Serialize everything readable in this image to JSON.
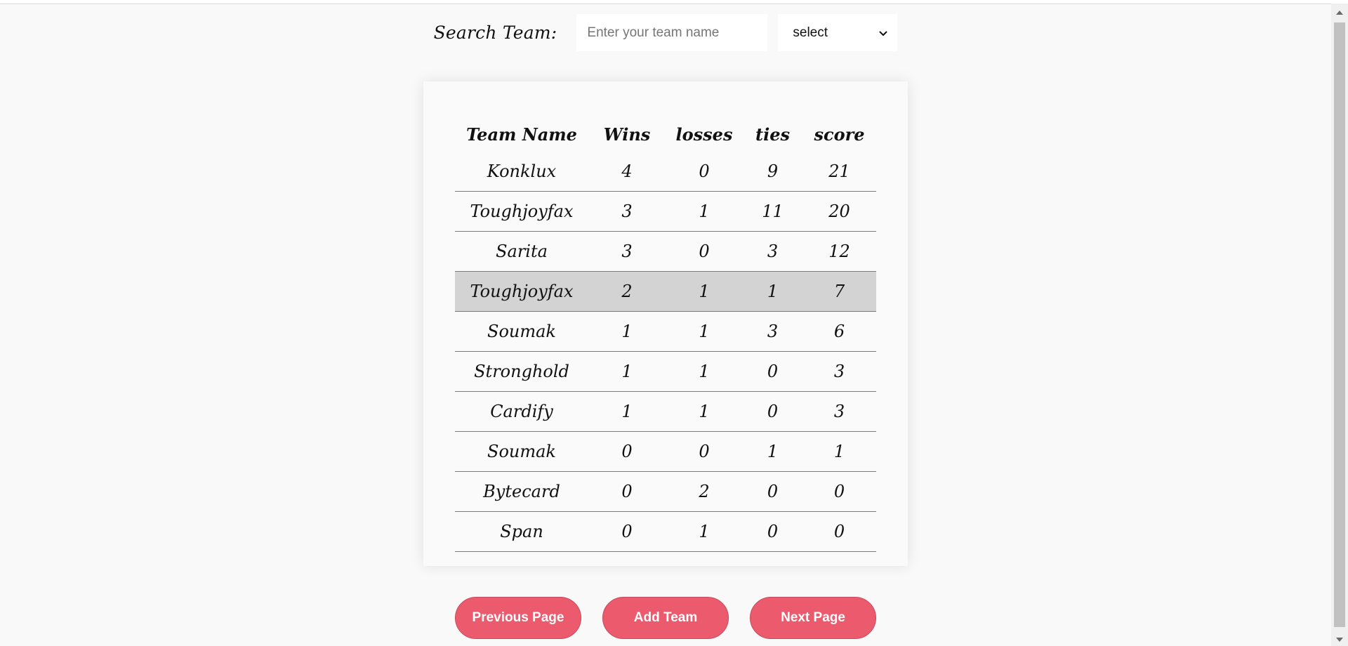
{
  "search": {
    "label": "Search Team:",
    "placeholder": "Enter your team name",
    "select_value": "select"
  },
  "table": {
    "headers": {
      "name": "Team Name",
      "wins": "Wins",
      "losses": "losses",
      "ties": "ties",
      "score": "score"
    },
    "rows": [
      {
        "name": "Konklux",
        "wins": "4",
        "losses": "0",
        "ties": "9",
        "score": "21"
      },
      {
        "name": "Toughjoyfax",
        "wins": "3",
        "losses": "1",
        "ties": "11",
        "score": "20"
      },
      {
        "name": "Sarita",
        "wins": "3",
        "losses": "0",
        "ties": "3",
        "score": "12"
      },
      {
        "name": "Toughjoyfax",
        "wins": "2",
        "losses": "1",
        "ties": "1",
        "score": "7"
      },
      {
        "name": "Soumak",
        "wins": "1",
        "losses": "1",
        "ties": "3",
        "score": "6"
      },
      {
        "name": "Stronghold",
        "wins": "1",
        "losses": "1",
        "ties": "0",
        "score": "3"
      },
      {
        "name": "Cardify",
        "wins": "1",
        "losses": "1",
        "ties": "0",
        "score": "3"
      },
      {
        "name": "Soumak",
        "wins": "0",
        "losses": "0",
        "ties": "1",
        "score": "1"
      },
      {
        "name": "Bytecard",
        "wins": "0",
        "losses": "2",
        "ties": "0",
        "score": "0"
      },
      {
        "name": "Span",
        "wins": "0",
        "losses": "1",
        "ties": "0",
        "score": "0"
      }
    ]
  },
  "buttons": {
    "previous": "Previous Page",
    "add": "Add Team",
    "next": "Next Page"
  },
  "colors": {
    "button_bg": "#ec5a6d",
    "highlight_row": "#d3d3d3",
    "page_bg": "#f9f9f9"
  },
  "icons": {
    "select_chevron": "chevron-down-icon"
  }
}
